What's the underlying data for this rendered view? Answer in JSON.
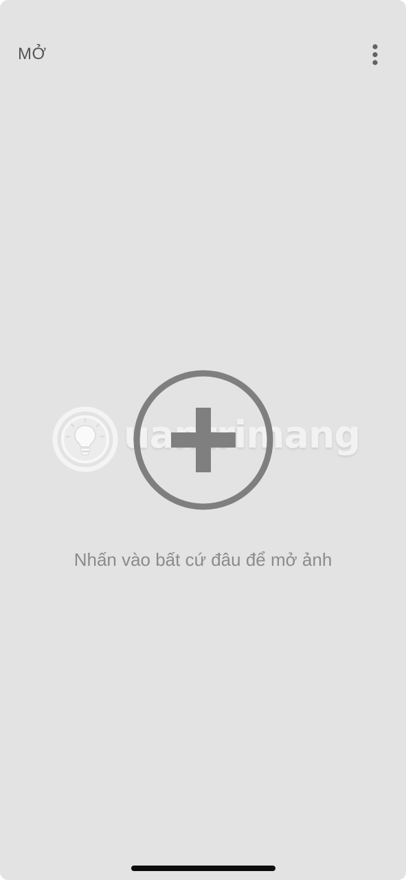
{
  "header": {
    "open_label": "MỞ",
    "more_icon": "more-vertical-icon"
  },
  "main": {
    "add_icon": "plus-circle-icon",
    "hint": "Nhấn vào bất cứ đâu để mở ảnh"
  },
  "watermark": {
    "icon": "lightbulb-icon",
    "text": "uantrimang"
  },
  "colors": {
    "background": "#e3e3e3",
    "icon_gray": "#7f7f7f",
    "text_gray": "#8b8b8b",
    "label_dark": "#555555"
  }
}
